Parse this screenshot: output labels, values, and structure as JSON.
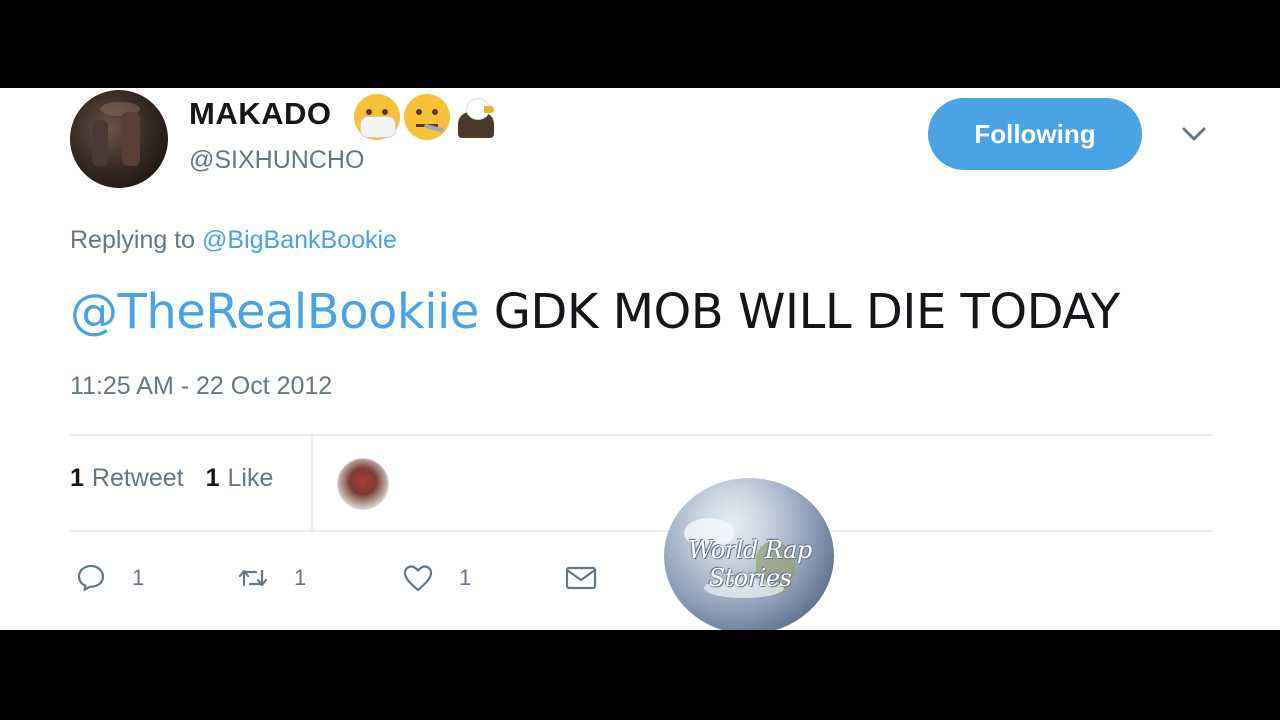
{
  "user": {
    "display_name": "MAKADO",
    "handle": "@SIXHUNCHO",
    "emojis": [
      "face-with-medical-mask",
      "face-with-thermometer",
      "eagle"
    ]
  },
  "follow_button": {
    "label": "Following"
  },
  "reply": {
    "prefix": "Replying to",
    "to_handle": "@BigBankBookie"
  },
  "tweet": {
    "mention": "@TheRealBookiie",
    "text": "GDK MOB WILL DIE TODAY"
  },
  "timestamp": "11:25 AM - 22 Oct 2012",
  "stats": {
    "retweets_count": "1",
    "retweets_label": "Retweet",
    "likes_count": "1",
    "likes_label": "Like"
  },
  "actions": {
    "reply_count": "1",
    "retweet_count": "1",
    "like_count": "1"
  },
  "watermark": "World Rap Stories",
  "colors": {
    "accent": "#4aa3e2",
    "text_primary": "#14171a",
    "text_secondary": "#657786",
    "divider": "#e6ecf0",
    "letterbox": "#000000"
  }
}
